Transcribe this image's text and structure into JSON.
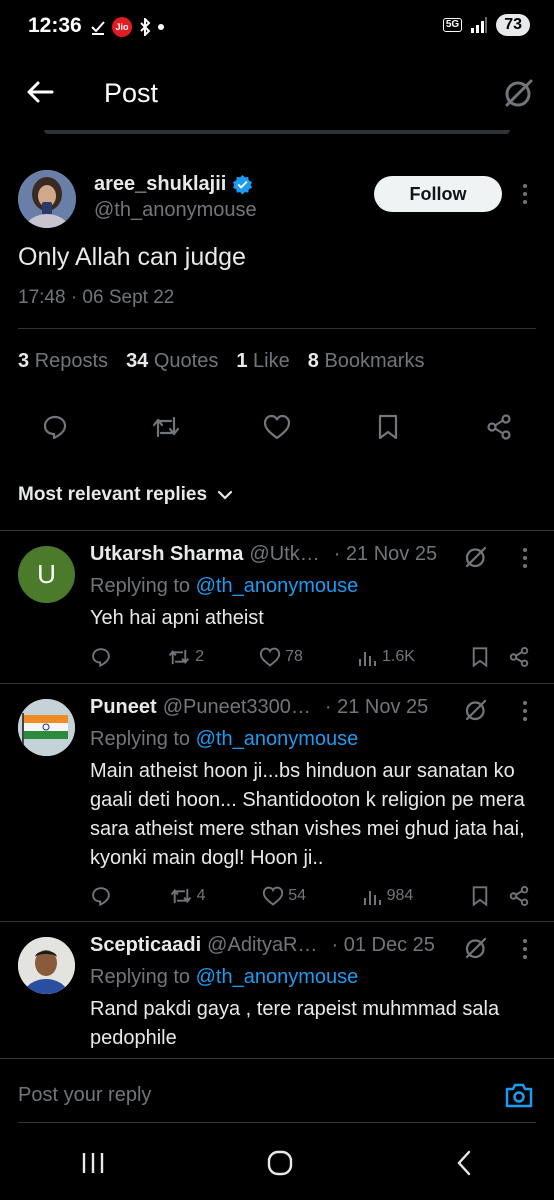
{
  "status_bar": {
    "time": "12:36",
    "carrier": "Jio",
    "network": "5G",
    "battery": "73"
  },
  "header": {
    "title": "Post"
  },
  "post": {
    "author_name": "aree_shuklajii",
    "author_handle": "@th_anonymouse",
    "follow_label": "Follow",
    "text": "Only Allah can judge",
    "timestamp": "17:48 · 06 Sept 22",
    "stats": [
      {
        "count": "3",
        "label": "Reposts"
      },
      {
        "count": "34",
        "label": "Quotes"
      },
      {
        "count": "1",
        "label": "Like"
      },
      {
        "count": "8",
        "label": "Bookmarks"
      }
    ]
  },
  "replies_filter": {
    "label": "Most relevant replies"
  },
  "replies": [
    {
      "avatar_letter": "U",
      "avatar_color": "#4a7a2a",
      "name": "Utkarsh Sharma",
      "handle": "@Utk…",
      "date": "· 21 Nov 25",
      "replying_prefix": "Replying to",
      "replying_to": "@th_anonymouse",
      "text": "Yeh hai apni atheist",
      "reposts": "2",
      "likes": "78",
      "views": "1.6K"
    },
    {
      "name": "Puneet",
      "handle": "@Puneet3300…",
      "date": "· 21 Nov 25",
      "replying_prefix": "Replying to",
      "replying_to": "@th_anonymouse",
      "text": "Main atheist hoon ji...bs hinduon aur sanatan ko gaali deti hoon... Shantidooton k religion pe mera sara atheist mere sthan vishes mei ghud jata hai, kyonki main dogl! Hoon ji..",
      "reposts": "4",
      "likes": "54",
      "views": "984"
    },
    {
      "name": "Scepticaadi",
      "handle": "@AdityaR…",
      "date": "· 01 Dec 25",
      "replying_prefix": "Replying to",
      "replying_to": "@th_anonymouse",
      "text": "Rand pakdi gaya , tere rapeist muhmmad sala pedophile"
    }
  ],
  "reply_bar": {
    "placeholder": "Post your reply"
  },
  "colors": {
    "accent": "#1d9bf0",
    "muted": "#71767b",
    "text": "#e7e9ea",
    "divider": "#2f3336"
  }
}
